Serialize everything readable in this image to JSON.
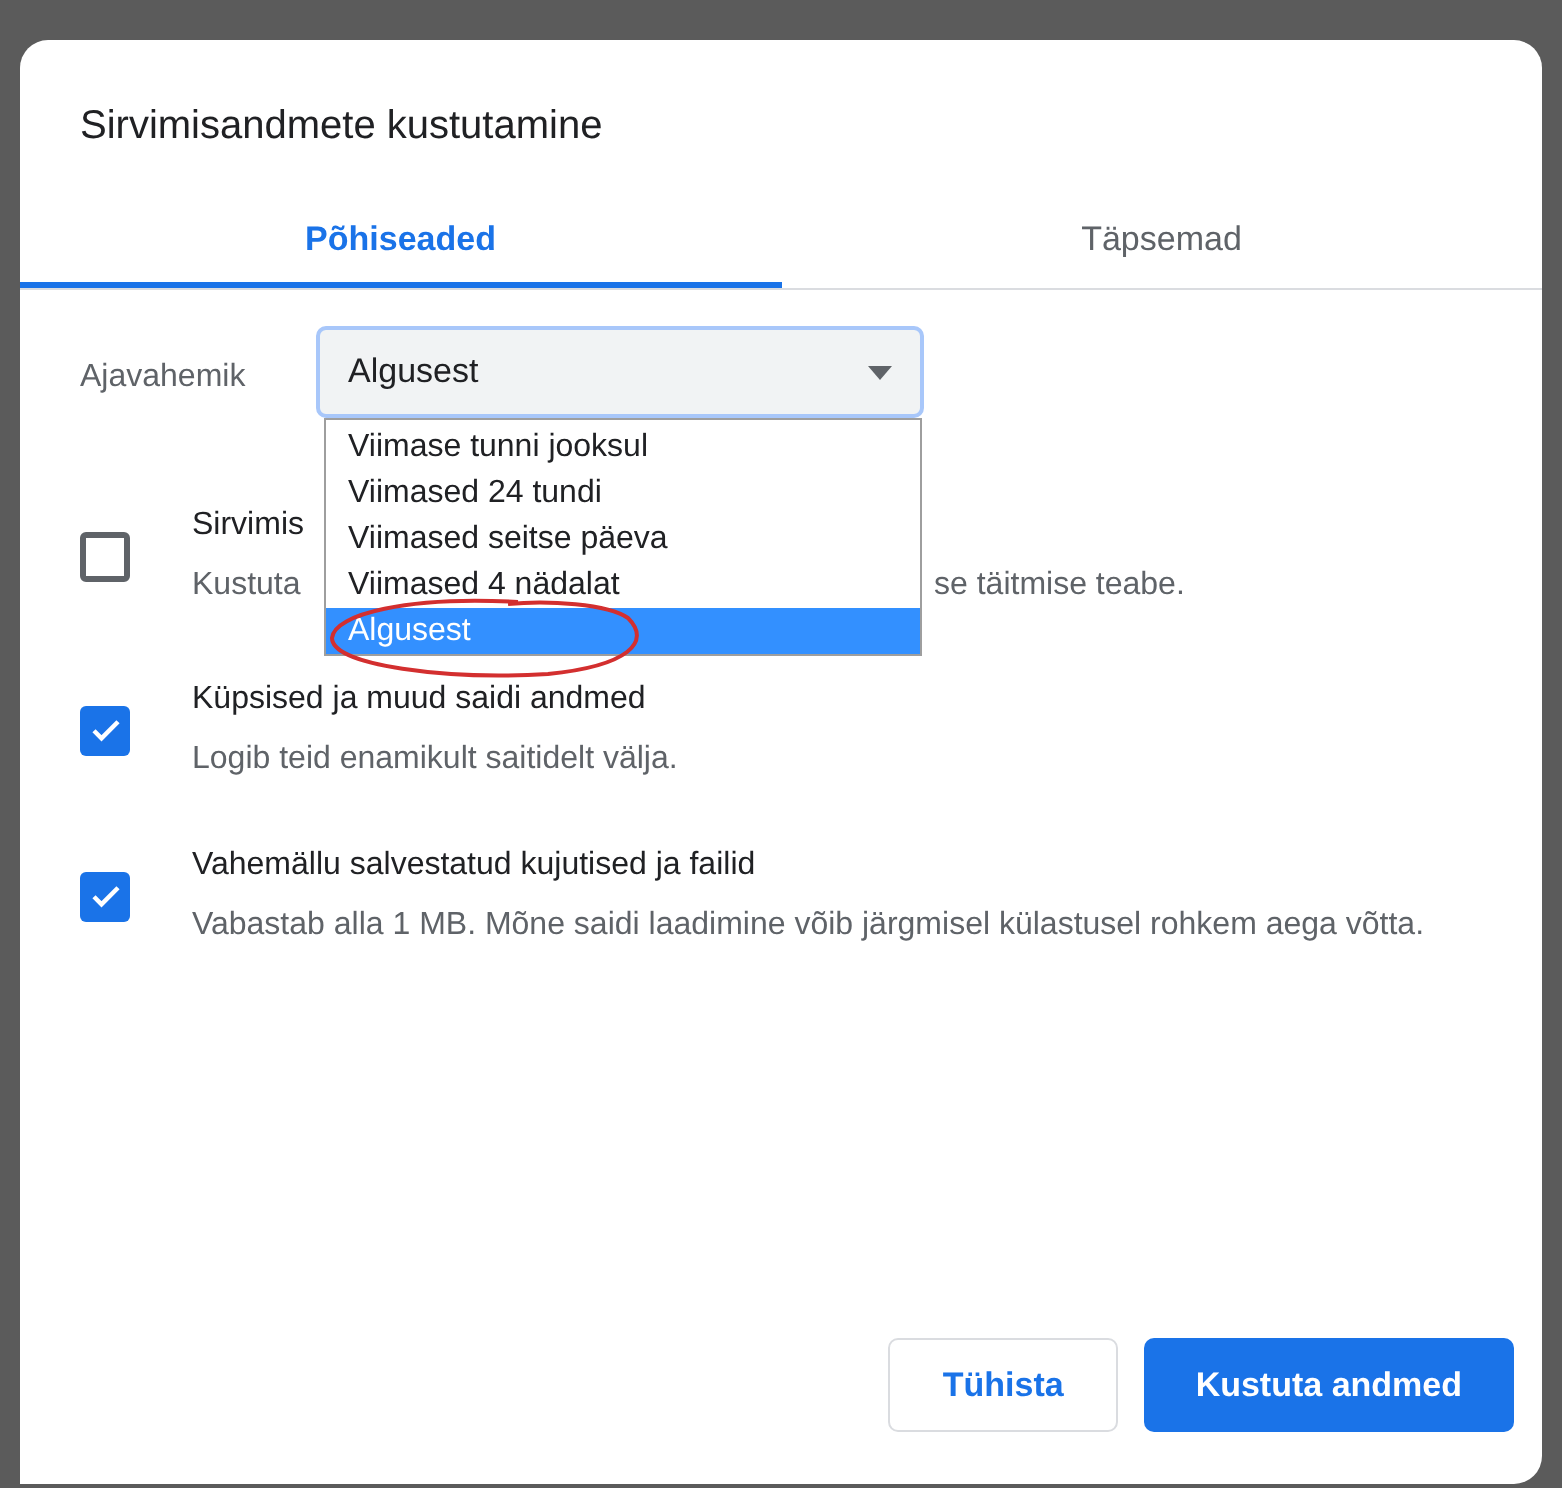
{
  "dialog": {
    "title": "Sirvimisandmete kustutamine"
  },
  "tabs": [
    {
      "label": "Põhiseaded",
      "selected": true
    },
    {
      "label": "Täpsemad",
      "selected": false
    }
  ],
  "time_range": {
    "label": "Ajavahemik",
    "value": "Algusest",
    "expanded": true,
    "options": [
      {
        "label": "Viimase tunni jooksul",
        "selected": false
      },
      {
        "label": "Viimased 24 tundi",
        "selected": false
      },
      {
        "label": "Viimased seitse päeva",
        "selected": false
      },
      {
        "label": "Viimased 4 nädalat",
        "selected": false
      },
      {
        "label": "Algusest",
        "selected": true
      }
    ]
  },
  "options": [
    {
      "title": "Sirvimis",
      "description_parts": [
        "Kustuta",
        "se täitmise teabe."
      ],
      "checked": false
    },
    {
      "title": "Küpsised ja muud saidi andmed",
      "description_parts": [
        "Logib teid enamikult saitidelt välja."
      ],
      "checked": true
    },
    {
      "title": "Vahemällu salvestatud kujutised ja failid",
      "description_parts": [
        "Vabastab alla 1 MB. Mõne saidi laadimine võib järgmisel külastusel rohkem aega võtta."
      ],
      "checked": true
    }
  ],
  "buttons": [
    {
      "label": "Tühista",
      "kind": "secondary"
    },
    {
      "label": "Kustuta andmed",
      "kind": "primary"
    }
  ]
}
